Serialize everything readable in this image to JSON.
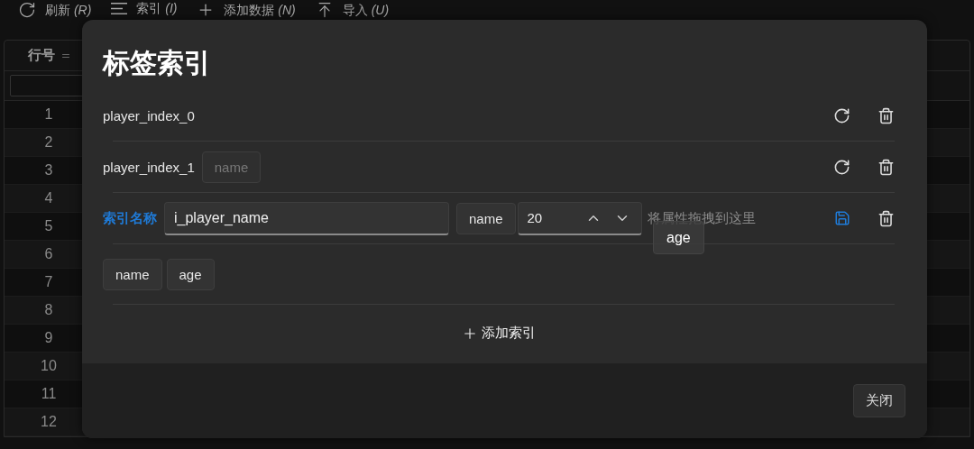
{
  "toolbar": [
    {
      "kind": "refresh",
      "label": "刷新",
      "shortcut": "(R)"
    },
    {
      "kind": "list",
      "label": "索引",
      "shortcut": "(I)"
    },
    {
      "kind": "add",
      "label": "添加数据",
      "shortcut": "(N)"
    },
    {
      "kind": "import",
      "label": "导入",
      "shortcut": "(U)"
    }
  ],
  "table": {
    "header": "行号",
    "rows": [
      {
        "cells": [
          "1"
        ]
      },
      {
        "cells": [
          "2"
        ]
      },
      {
        "cells": [
          "3"
        ]
      },
      {
        "cells": [
          "4"
        ]
      },
      {
        "cells": [
          "5"
        ]
      },
      {
        "cells": [
          "6"
        ]
      },
      {
        "cells": [
          "7"
        ]
      },
      {
        "cells": [
          "8"
        ]
      },
      {
        "cells": [
          "9"
        ]
      },
      {
        "cells": [
          "10"
        ]
      },
      {
        "cells": [
          "11"
        ]
      },
      {
        "cells": [
          "12"
        ]
      }
    ]
  },
  "dialog": {
    "title": "标签索引",
    "indexes": [
      {
        "name": "player_index_0"
      },
      {
        "name": "player_index_1",
        "fields": [
          "name"
        ]
      }
    ],
    "editor": {
      "label": "索引名称",
      "value": "i_player_name",
      "fields": [
        "name"
      ],
      "length": "20",
      "drop_hint": "将属性拖拽到这里",
      "dragging": "age"
    },
    "available_fields": [
      "name",
      "age"
    ],
    "add_button": "添加索引",
    "close_button": "关闭"
  }
}
